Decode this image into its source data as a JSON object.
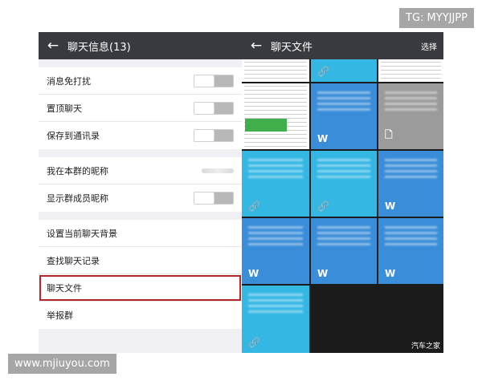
{
  "watermarks": {
    "top_right": "TG: MYYJJPP",
    "bottom_left": "www.mjiuyou.com",
    "bottom_right": "汽车之家"
  },
  "left_panel": {
    "back_icon": "arrow-left-icon",
    "title": "聊天信息(13)",
    "group1": [
      {
        "label": "消息免打扰",
        "toggle": false
      },
      {
        "label": "置顶聊天",
        "toggle": false
      },
      {
        "label": "保存到通讯录",
        "toggle": false
      }
    ],
    "group2": [
      {
        "label": "我在本群的昵称",
        "value_blurred": true
      },
      {
        "label": "显示群成员昵称",
        "toggle": false
      }
    ],
    "group3": [
      {
        "label": "设置当前聊天背景"
      },
      {
        "label": "查找聊天记录"
      },
      {
        "label": "聊天文件",
        "highlighted": true
      },
      {
        "label": "举报群"
      }
    ]
  },
  "right_panel": {
    "back_icon": "arrow-left-icon",
    "title": "聊天文件",
    "select_label": "选择",
    "colors": {
      "light_blue": "#35b7e4",
      "blue": "#3a8dd9",
      "gray": "#9b9b9b"
    }
  }
}
